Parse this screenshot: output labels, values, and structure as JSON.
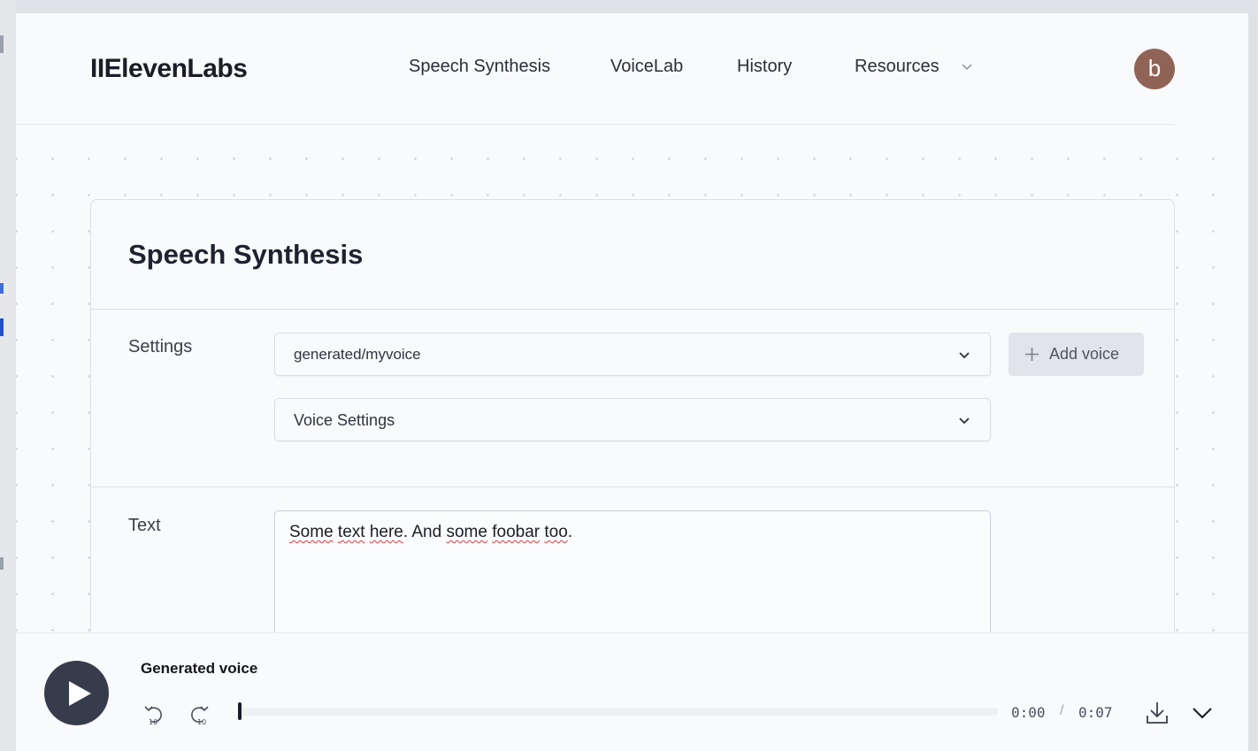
{
  "header": {
    "logo": "IIElevenLabs",
    "nav": [
      {
        "label": "Speech Synthesis"
      },
      {
        "label": "VoiceLab"
      },
      {
        "label": "History"
      },
      {
        "label": "Resources"
      }
    ],
    "avatar_letter": "b"
  },
  "card": {
    "title": "Speech Synthesis",
    "settings_label": "Settings",
    "voice_select": "generated/myvoice",
    "voice_settings": "Voice Settings",
    "add_voice": "Add voice",
    "text_label": "Text",
    "text_value": {
      "w1": "Some",
      "w2": "text",
      "w3": "here",
      "p1": ". And ",
      "w4": "some",
      "sp1": " ",
      "w5": "foobar",
      "sp2": " ",
      "w6": "too",
      "p2": "."
    }
  },
  "player": {
    "title": "Generated voice",
    "current_time": "0:00",
    "separator": "/",
    "duration": "0:07",
    "progress": 0
  },
  "colors": {
    "accent_dark": "#363c4c",
    "avatar": "#8f6456",
    "spellcheck": "#e0383e"
  }
}
